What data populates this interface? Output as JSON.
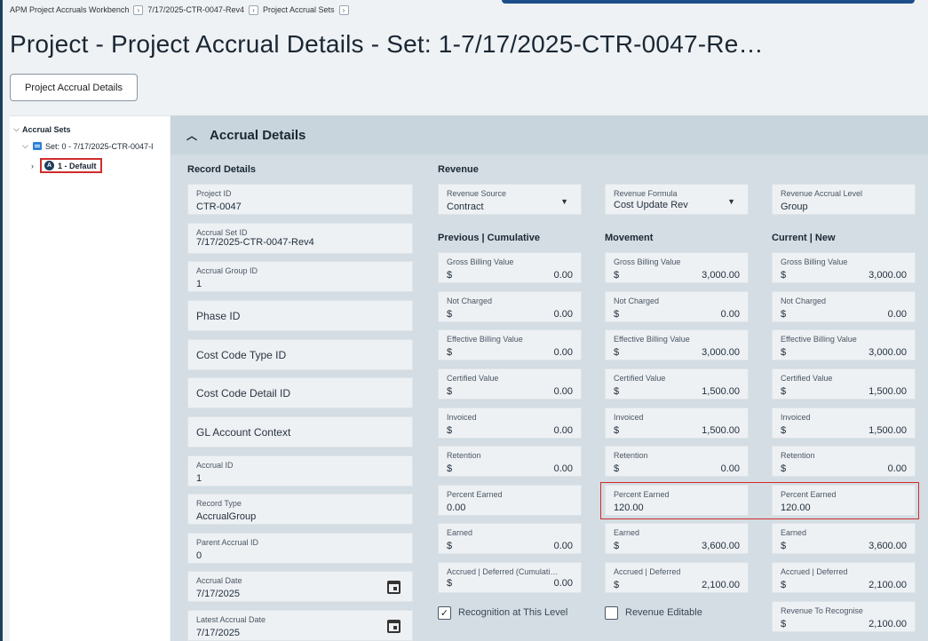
{
  "breadcrumb": [
    "APM Project Accruals Workbench",
    "7/17/2025-CTR-0047-Rev4",
    "Project Accrual Sets"
  ],
  "page_title": "Project - Project Accrual Details - Set: 1-7/17/2025-CTR-0047-Re…",
  "details_button": "Project Accrual Details",
  "tree": {
    "root": "Accrual Sets",
    "set": "Set: 0 - 7/17/2025-CTR-0047-I",
    "item": "1 - Default",
    "item_badge": "A"
  },
  "section": {
    "title": "Accrual Details"
  },
  "record_details": {
    "title": "Record Details",
    "fields": [
      {
        "label": "Project ID",
        "value": "CTR-0047"
      },
      {
        "label": "Accrual Set ID",
        "value": "7/17/2025-CTR-0047-Rev4"
      },
      {
        "label": "Accrual Group ID",
        "value": "1"
      },
      {
        "label": "Phase ID",
        "value": ""
      },
      {
        "label": "Cost Code Type ID",
        "value": ""
      },
      {
        "label": "Cost Code Detail ID",
        "value": ""
      },
      {
        "label": "GL Account Context",
        "value": ""
      },
      {
        "label": "Accrual ID",
        "value": "1"
      },
      {
        "label": "Record Type",
        "value": "AccrualGroup"
      },
      {
        "label": "Parent Accrual ID",
        "value": "0"
      },
      {
        "label": "Accrual Date",
        "value": "7/17/2025"
      },
      {
        "label": "Latest Accrual Date",
        "value": "7/17/2025"
      }
    ]
  },
  "revenue": {
    "title": "Revenue",
    "source": {
      "label": "Revenue Source",
      "value": "Contract"
    },
    "formula": {
      "label": "Revenue Formula",
      "value": "Cost Update Rev"
    },
    "level": {
      "label": "Revenue Accrual Level",
      "value": "Group"
    }
  },
  "currency": "$",
  "previous": {
    "title": "Previous | Cumulative",
    "gross": {
      "label": "Gross Billing Value",
      "value": "0.00"
    },
    "not_charged": {
      "label": "Not Charged",
      "value": "0.00"
    },
    "effective": {
      "label": "Effective Billing Value",
      "value": "0.00"
    },
    "certified": {
      "label": "Certified Value",
      "value": "0.00"
    },
    "invoiced": {
      "label": "Invoiced",
      "value": "0.00"
    },
    "retention": {
      "label": "Retention",
      "value": "0.00"
    },
    "percent": {
      "label": "Percent Earned",
      "value": "0.00"
    },
    "earned": {
      "label": "Earned",
      "value": "0.00"
    },
    "accrued": {
      "label": "Accrued | Deferred (Cumulati…",
      "value": "0.00"
    }
  },
  "movement": {
    "title": "Movement",
    "gross": {
      "label": "Gross Billing Value",
      "value": "3,000.00"
    },
    "not_charged": {
      "label": "Not Charged",
      "value": "0.00"
    },
    "effective": {
      "label": "Effective Billing Value",
      "value": "3,000.00"
    },
    "certified": {
      "label": "Certified Value",
      "value": "1,500.00"
    },
    "invoiced": {
      "label": "Invoiced",
      "value": "1,500.00"
    },
    "retention": {
      "label": "Retention",
      "value": "0.00"
    },
    "percent": {
      "label": "Percent Earned",
      "value": "120.00"
    },
    "earned": {
      "label": "Earned",
      "value": "3,600.00"
    },
    "accrued": {
      "label": "Accrued | Deferred",
      "value": "2,100.00"
    }
  },
  "current": {
    "title": "Current | New",
    "gross": {
      "label": "Gross Billing Value",
      "value": "3,000.00"
    },
    "not_charged": {
      "label": "Not Charged",
      "value": "0.00"
    },
    "effective": {
      "label": "Effective Billing Value",
      "value": "3,000.00"
    },
    "certified": {
      "label": "Certified Value",
      "value": "1,500.00"
    },
    "invoiced": {
      "label": "Invoiced",
      "value": "1,500.00"
    },
    "retention": {
      "label": "Retention",
      "value": "0.00"
    },
    "percent": {
      "label": "Percent Earned",
      "value": "120.00"
    },
    "earned": {
      "label": "Earned",
      "value": "3,600.00"
    },
    "accrued": {
      "label": "Accrued | Deferred",
      "value": "2,100.00"
    },
    "to_recognise": {
      "label": "Revenue To Recognise",
      "value": "2,100.00"
    }
  },
  "checkboxes": {
    "recognition": {
      "label": "Recognition at This Level",
      "checked": true
    },
    "editable": {
      "label": "Revenue Editable",
      "checked": false
    }
  },
  "icons": {
    "check": "check-icon",
    "calendar": "calendar-icon",
    "dropdown": "dropdown-arrow-icon"
  },
  "colors": {
    "highlight": "#d12b2b",
    "header": "#c9d5dc",
    "panel": "#d3dde3"
  }
}
